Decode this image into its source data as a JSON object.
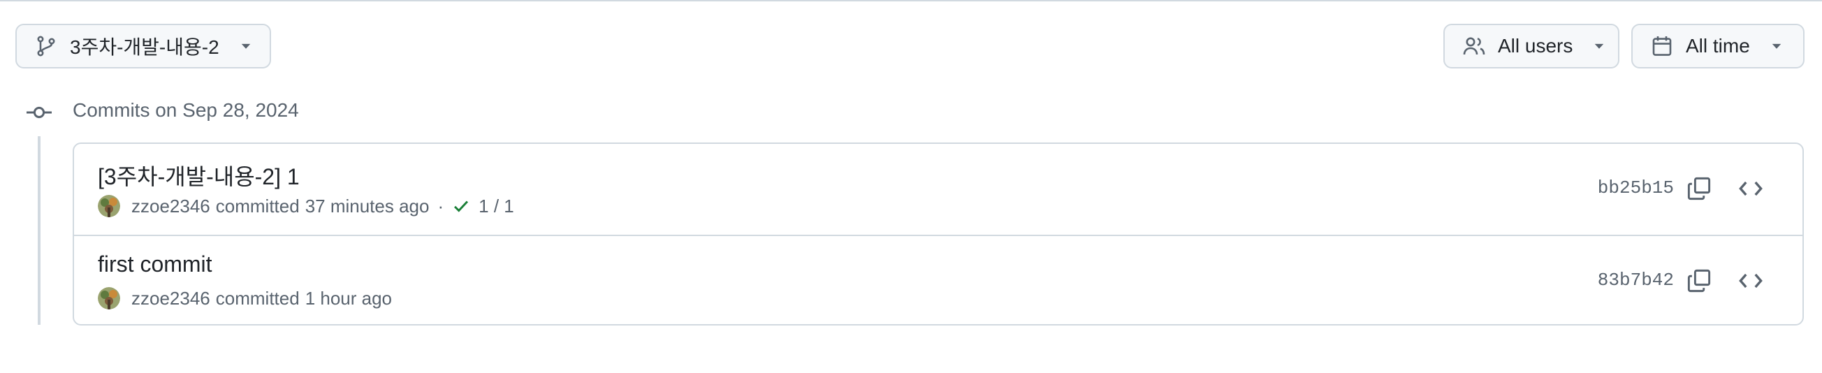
{
  "filters": {
    "branch": {
      "label": "3주차-개발-내용-2",
      "icon": "git-branch-icon"
    },
    "users": {
      "label": "All users",
      "icon": "people-icon"
    },
    "time": {
      "label": "All time",
      "icon": "calendar-icon"
    }
  },
  "group": {
    "heading": "Commits on Sep 28, 2024",
    "icon": "git-commit-icon"
  },
  "commits": [
    {
      "title": "[3주차-개발-내용-2] 1",
      "author": "zzoe2346",
      "action": "committed",
      "time": "37 minutes ago",
      "separator": "·",
      "checks": "1 / 1",
      "sha": "bb25b15"
    },
    {
      "title": "first commit",
      "author": "zzoe2346",
      "action": "committed",
      "time": "1 hour ago",
      "sha": "83b7b42"
    }
  ],
  "colors": {
    "success": "#1a7f37",
    "border": "#d1d9e0",
    "muted": "#59636e"
  }
}
